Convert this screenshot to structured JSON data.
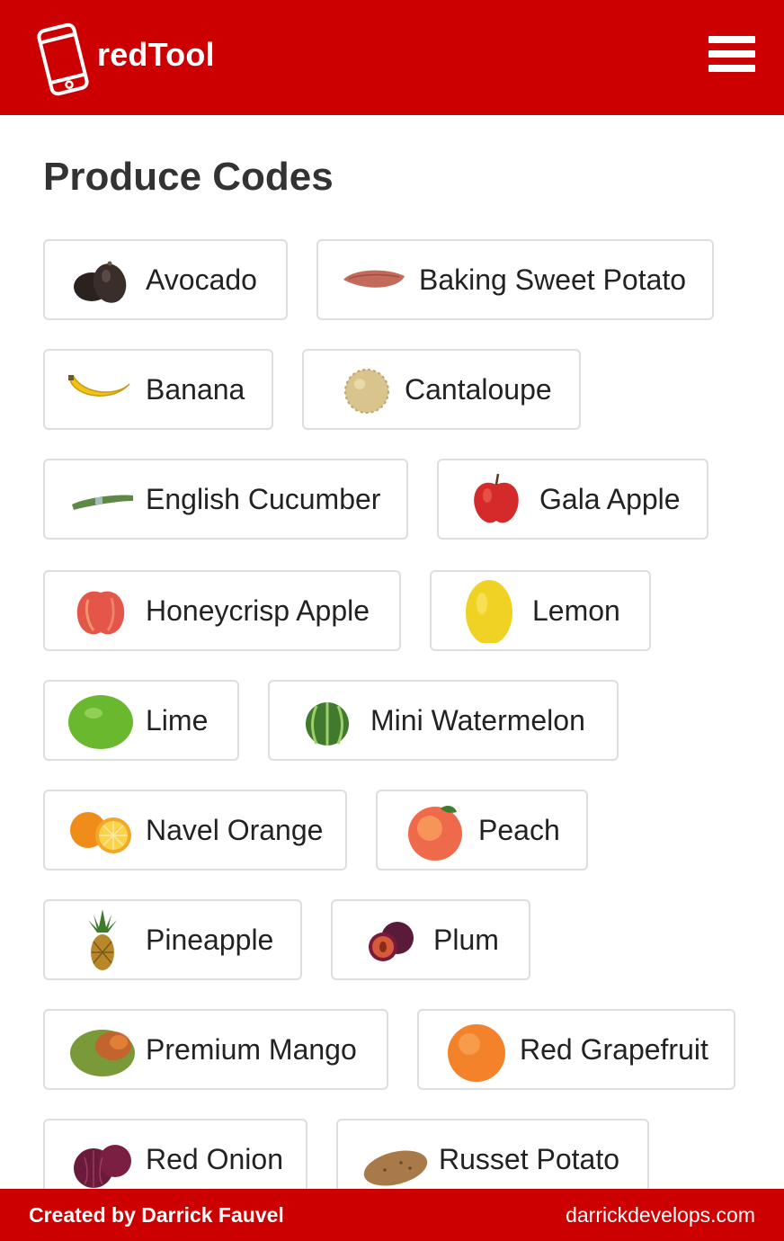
{
  "app": {
    "name": "redTool",
    "brand_color": "#cc0000",
    "logo_icon": "smartphone-icon",
    "menu_icon": "hamburger-menu-icon"
  },
  "main": {
    "title": "Produce Codes",
    "items": [
      {
        "label": "Avocado",
        "icon": "avocado-icon"
      },
      {
        "label": "Baking Sweet Potato",
        "icon": "sweet-potato-icon"
      },
      {
        "label": "Banana",
        "icon": "banana-icon"
      },
      {
        "label": "Cantaloupe",
        "icon": "cantaloupe-icon"
      },
      {
        "label": "English Cucumber",
        "icon": "cucumber-icon"
      },
      {
        "label": "Gala Apple",
        "icon": "gala-apple-icon"
      },
      {
        "label": "Honeycrisp Apple",
        "icon": "honeycrisp-apple-icon"
      },
      {
        "label": "Lemon",
        "icon": "lemon-icon"
      },
      {
        "label": "Lime",
        "icon": "lime-icon"
      },
      {
        "label": "Mini Watermelon",
        "icon": "watermelon-icon"
      },
      {
        "label": "Navel Orange",
        "icon": "orange-icon"
      },
      {
        "label": "Peach",
        "icon": "peach-icon"
      },
      {
        "label": "Pineapple",
        "icon": "pineapple-icon"
      },
      {
        "label": "Plum",
        "icon": "plum-icon"
      },
      {
        "label": "Premium Mango",
        "icon": "mango-icon"
      },
      {
        "label": "Red Grapefruit",
        "icon": "grapefruit-icon"
      },
      {
        "label": "Red Onion",
        "icon": "red-onion-icon"
      },
      {
        "label": "Russet Potato",
        "icon": "potato-icon"
      }
    ]
  },
  "footer": {
    "credit": "Created by Darrick Fauvel",
    "link": "darrickdevelops.com"
  }
}
